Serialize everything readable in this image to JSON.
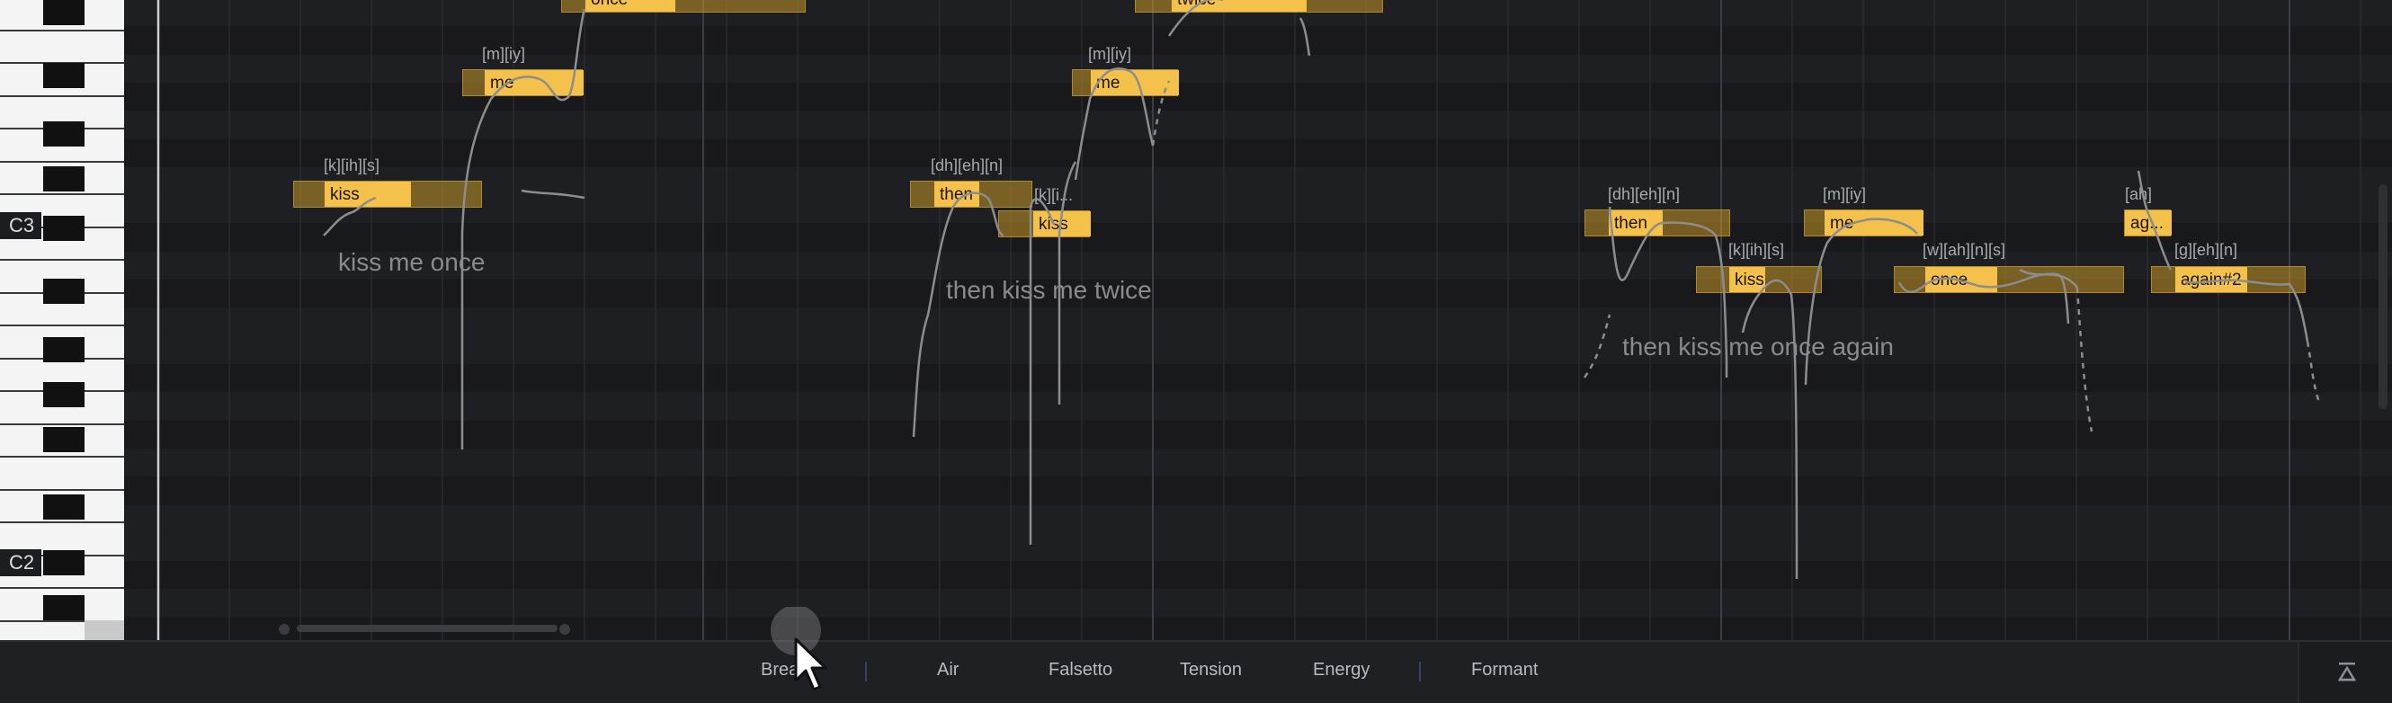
{
  "piano": {
    "octave_labels": [
      "C3",
      "C2"
    ]
  },
  "notes": [
    {
      "lyric": "kiss"
    },
    {
      "lyric": "me"
    },
    {
      "lyric": "once"
    },
    {
      "lyric": "then"
    },
    {
      "lyric": "kiss"
    },
    {
      "lyric": "me"
    },
    {
      "lyric": "twice"
    },
    {
      "lyric": "then"
    },
    {
      "lyric": "kiss"
    },
    {
      "lyric": "me"
    },
    {
      "lyric": "once"
    },
    {
      "lyric": "ag..."
    },
    {
      "lyric": "again#2"
    }
  ],
  "phonemes": [
    "[k][ih][s]",
    "[m][iy]",
    "[dh][eh][n]",
    "[k][i...",
    "[m][iy]",
    "[dh][eh][n]",
    "[k][ih][s]",
    "[m][iy]",
    "[w][ah][n][s]",
    "[ah]",
    "[g][eh][n]"
  ],
  "lyric_phrases": [
    "kiss me once",
    "then kiss me twice",
    "then kiss me once again"
  ],
  "parameter_tabs": [
    "Brea",
    "Air",
    "Falsetto",
    "Tension",
    "Energy",
    "Formant"
  ],
  "icons": {
    "collapse": "collapse-panel-icon",
    "cursor": "mouse-pointer-icon"
  },
  "colors": {
    "note": "#f4c24a",
    "background": "#1c1d20"
  }
}
